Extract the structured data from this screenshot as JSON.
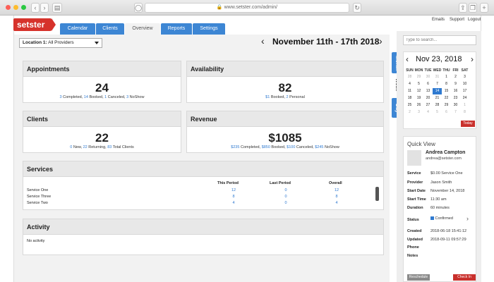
{
  "browser": {
    "url": "www.setster.com/admin/"
  },
  "brand": {
    "logo": "setster"
  },
  "nav": {
    "tabs": [
      {
        "label": "Calendar"
      },
      {
        "label": "Clients"
      },
      {
        "label": "Overview"
      },
      {
        "label": "Reports"
      },
      {
        "label": "Settings"
      }
    ],
    "top_links": [
      "Emails",
      "Support",
      "Logout"
    ]
  },
  "filter": {
    "location_label": "Location 1:",
    "location_value": "All Providers"
  },
  "range": {
    "title": "November 11th - 17th 2018"
  },
  "cards": {
    "appointments": {
      "title": "Appointments",
      "value": "24",
      "completed": "3",
      "completed_label": "Completed,",
      "booked": "14",
      "booked_label": "Booked,",
      "canceled": "1",
      "canceled_label": "Canceled,",
      "noshow": "3",
      "noshow_label": "NoShow"
    },
    "availability": {
      "title": "Availability",
      "value": "82",
      "booked": "$1",
      "booked_label": "Booked,",
      "personal": "2",
      "personal_label": "Personal"
    },
    "clients": {
      "title": "Clients",
      "value": "22",
      "new": "0",
      "new_label": "New,",
      "returning": "22",
      "returning_label": "Returning,",
      "total": "83",
      "total_label": "Total Clients"
    },
    "revenue": {
      "title": "Revenue",
      "value": "$1085",
      "completed": "$235",
      "completed_label": "Completed,",
      "booked": "$850",
      "booked_label": "Booked,",
      "canceled": "$100",
      "canceled_label": "Canceled,",
      "noshow": "$245",
      "noshow_label": "NoShow"
    }
  },
  "services": {
    "title": "Services",
    "headers": [
      "This Period",
      "Last Period",
      "Overall"
    ],
    "rows": [
      {
        "name": "Service One",
        "this": "12",
        "last": "0",
        "overall": "12"
      },
      {
        "name": "Service Three",
        "this": "8",
        "last": "0",
        "overall": "8"
      },
      {
        "name": "Service Two",
        "this": "4",
        "last": "0",
        "overall": "4"
      }
    ]
  },
  "activity": {
    "title": "Activity",
    "empty": "No activity"
  },
  "view_tabs": [
    "Month",
    "Week",
    "Day"
  ],
  "sidebar": {
    "search_placeholder": "Type to search...",
    "calendar": {
      "title": "Nov 23, 2018",
      "dow": [
        "SUN",
        "MON",
        "TUE",
        "WED",
        "THU",
        "FRI",
        "SAT"
      ],
      "weeks": [
        [
          "28",
          "29",
          "30",
          "31",
          "1",
          "2",
          "3"
        ],
        [
          "4",
          "5",
          "6",
          "7",
          "8",
          "9",
          "10"
        ],
        [
          "11",
          "12",
          "13",
          "14",
          "15",
          "16",
          "17"
        ],
        [
          "18",
          "19",
          "20",
          "21",
          "22",
          "23",
          "24"
        ],
        [
          "25",
          "26",
          "27",
          "28",
          "29",
          "30",
          "1"
        ],
        [
          "2",
          "3",
          "4",
          "5",
          "6",
          "7",
          "8"
        ]
      ],
      "today_label": "Today"
    },
    "quick_view": {
      "title": "Quick View",
      "name": "Andrea Campton",
      "email": "andrea@setster.com",
      "fields": [
        {
          "label": "Service",
          "value": "$0.00 Service One"
        },
        {
          "label": "Provider",
          "value": "Jason Smith"
        },
        {
          "label": "Start Date",
          "value": "November 14, 2018"
        },
        {
          "label": "Start Time",
          "value": "11:30 am"
        },
        {
          "label": "Duration",
          "value": "60 minutes"
        }
      ],
      "status_label": "Status",
      "status_value": "Confirmed",
      "fields2": [
        {
          "label": "Created",
          "value": "2018-06-18 15:41:12"
        },
        {
          "label": "Updated",
          "value": "2018-09-11 09:57:29"
        },
        {
          "label": "Phone",
          "value": ""
        },
        {
          "label": "Notes",
          "value": ""
        }
      ],
      "reschedule_label": "Reschedule",
      "checkin_label": "Check In"
    }
  },
  "colors": {
    "brand": "#d6322b",
    "accent": "#3d86d4",
    "link": "#2f7ad0"
  }
}
